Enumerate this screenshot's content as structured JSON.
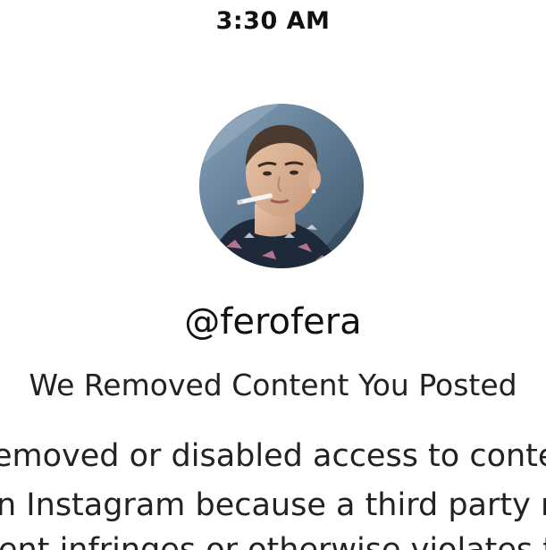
{
  "status_bar": {
    "time": "3:30 AM"
  },
  "profile": {
    "avatar_icon": "profile-photo",
    "username": "@ferofera"
  },
  "notice": {
    "title": "We Removed Content You Posted",
    "body_lines": [
      "emoved or disabled access to conten",
      "n Instagram because a third party rep",
      "ent infringes or otherwise violates th"
    ]
  }
}
